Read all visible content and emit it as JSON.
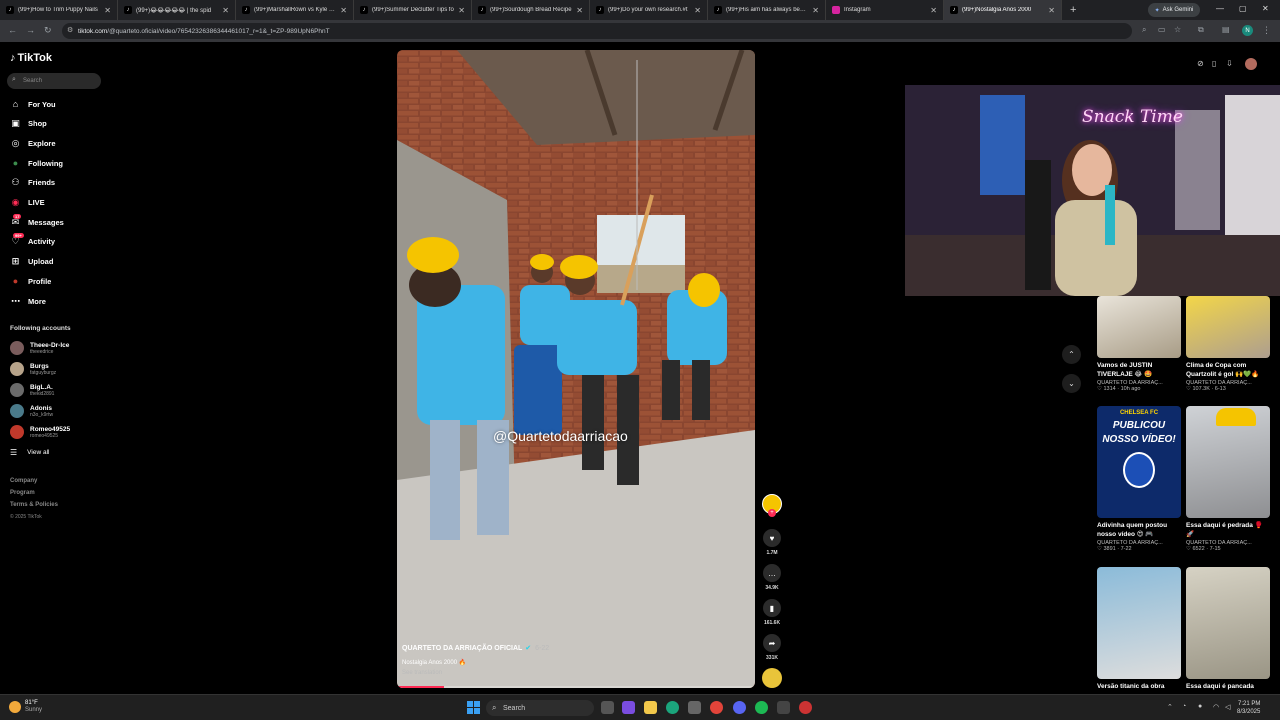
{
  "browser": {
    "tabs": [
      {
        "title": "(99+)How to Trim Puppy Nails",
        "icon": "tiktok-icon"
      },
      {
        "title": "(99+)😂😂😂😂😂 | the spid",
        "icon": "tiktok-icon"
      },
      {
        "title": "(99+)MarshallRown vs Kyle Fulle",
        "icon": "tiktok-icon"
      },
      {
        "title": "(99+)Summer Declutter Tips fo",
        "icon": "tiktok-icon"
      },
      {
        "title": "(99+)Sourdough Bread Recipe",
        "icon": "tiktok-icon"
      },
      {
        "title": "(99+)Do your own research.#t",
        "icon": "tiktok-icon"
      },
      {
        "title": "(99+)His aim has always been o",
        "icon": "tiktok-icon"
      },
      {
        "title": "Instagram",
        "icon": "instagram-icon"
      },
      {
        "title": "(99+)Nostalgia Anos 2000",
        "icon": "tiktok-icon",
        "active": true
      }
    ],
    "gemini_label": "Ask Gemini",
    "url_host": "tiktok.com",
    "url_path": "/@quarteto.oficial/video/7654232638634446101​7_r=1&_t=ZP-989UpN6PhnT",
    "profile_initial": "N"
  },
  "sidebar": {
    "logo": "TikTok",
    "search_placeholder": "Search",
    "nav": [
      {
        "label": "For You",
        "icon": "home-icon"
      },
      {
        "label": "Shop",
        "icon": "shop-bag-icon"
      },
      {
        "label": "Explore",
        "icon": "compass-icon"
      },
      {
        "label": "Following",
        "icon": "following-avatar-icon"
      },
      {
        "label": "Friends",
        "icon": "friends-icon"
      },
      {
        "label": "LIVE",
        "icon": "live-icon"
      },
      {
        "label": "Messages",
        "icon": "messages-icon",
        "badge": "17"
      },
      {
        "label": "Activity",
        "icon": "activity-icon",
        "badge": "99+"
      },
      {
        "label": "Upload",
        "icon": "upload-icon"
      },
      {
        "label": "Profile",
        "icon": "profile-avatar-icon"
      },
      {
        "label": "More",
        "icon": "more-dots-icon"
      }
    ],
    "following_title": "Following accounts",
    "accounts": [
      {
        "name": "Theee-Dr-Ice",
        "handle": "theeedrice"
      },
      {
        "name": "Burgs",
        "handle": "fatguyburgz"
      },
      {
        "name": "BigL.A.",
        "handle": "thekid2891"
      },
      {
        "name": "Adonis",
        "handle": "n3o_k9rtw"
      },
      {
        "name": "Romeo49525",
        "handle": "romeo49525"
      }
    ],
    "view_all": "View all",
    "footer": [
      "Company",
      "Program",
      "Terms & Policies",
      "© 2025 TikTok"
    ]
  },
  "video": {
    "watermark": "@Quartetodaarriacao",
    "author": "QUARTETO DA ARRIAÇÃO OFICIAL",
    "date": "6-22",
    "music": "Nostalgia Anos 2000 🔥",
    "see_translation": "See translation",
    "progress": 0.13
  },
  "actions": {
    "likes": "1.7M",
    "comments": "34.9K",
    "saves": "161.6K",
    "shares": "331K"
  },
  "webcam": {
    "neon_text": "Snack Time"
  },
  "related": [
    {
      "title": "Vamos de JUSTIN TIVERLAJE 😂 🤩",
      "author": "QUARTETO DA ARRIAÇ...",
      "stats": "♡ 1314 · 10h ago"
    },
    {
      "title": "Clima de Copa com Quartzolit é gol 🙌💚🔥",
      "author": "QUARTETO DA ARRIAÇ...",
      "stats": "♡ 107.3K · 6-13"
    },
    {
      "title": "Adivinha quem postou nosso vídeo 😍 🎮",
      "author": "QUARTETO DA ARRIAÇ...",
      "stats": "♡ 3891 · 7-22"
    },
    {
      "title": "Essa daqui é pedrada 🥊 🚀",
      "author": "QUARTETO DA ARRIAÇ...",
      "stats": "♡ 6522 · 7-15"
    },
    {
      "title": "Versão titanic da obra",
      "author": "",
      "stats": ""
    },
    {
      "title": "Essa daqui é pancada",
      "author": "",
      "stats": ""
    }
  ],
  "chelsea_thumb": {
    "line1": "CHELSEA FC",
    "line2": "PUBLICOU",
    "line3": "NOSSO VÍDEO!"
  },
  "taskbar": {
    "temp": "81°F",
    "condition": "Sunny",
    "search": "Search",
    "time": "7:21 PM",
    "date": "8/3/2025"
  },
  "colors": {
    "tiktok_red": "#fe2c55",
    "shirt_blue": "#3fb4e6",
    "helmet_yellow": "#f5c400"
  }
}
